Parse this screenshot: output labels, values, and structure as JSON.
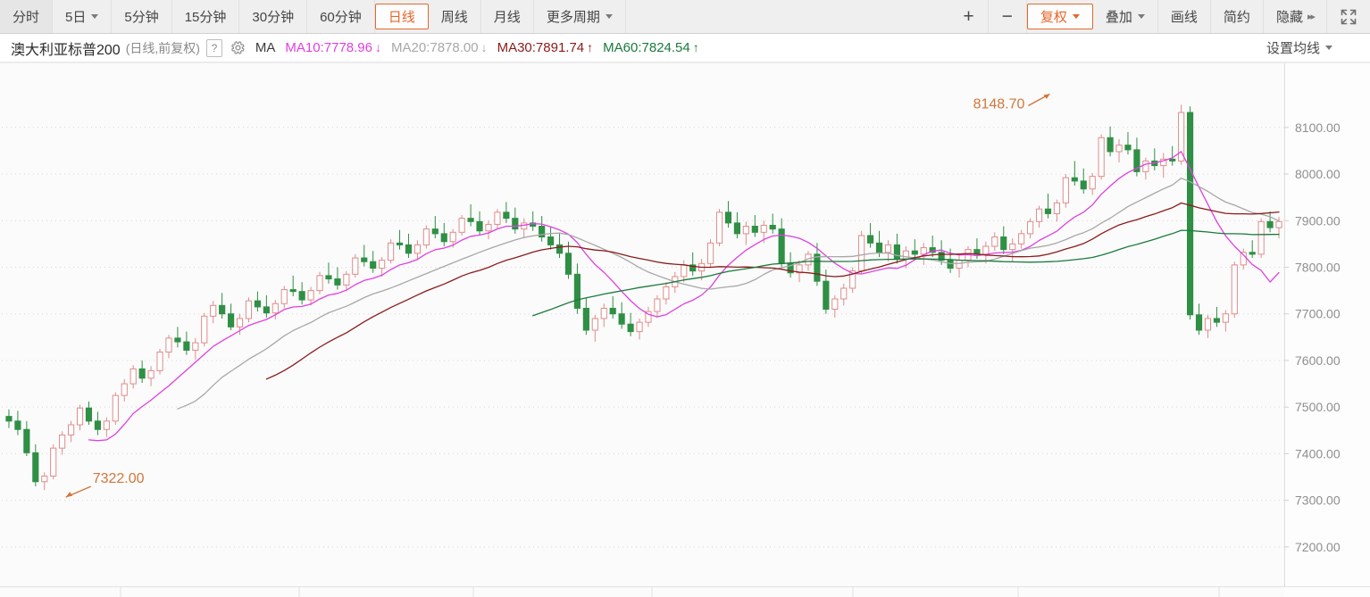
{
  "toolbar": {
    "left_items": [
      {
        "label": "分时",
        "name": "period-intraday",
        "active": false,
        "caret": false
      },
      {
        "label": "5日",
        "name": "period-5day",
        "active": false,
        "caret": true
      },
      {
        "label": "5分钟",
        "name": "period-5min",
        "active": false,
        "caret": false
      },
      {
        "label": "15分钟",
        "name": "period-15min",
        "active": false,
        "caret": false
      },
      {
        "label": "30分钟",
        "name": "period-30min",
        "active": false,
        "caret": false
      },
      {
        "label": "60分钟",
        "name": "period-60min",
        "active": false,
        "caret": false
      },
      {
        "label": "日线",
        "name": "period-daily",
        "active": true,
        "caret": false
      },
      {
        "label": "周线",
        "name": "period-weekly",
        "active": false,
        "caret": false
      },
      {
        "label": "月线",
        "name": "period-monthly",
        "active": false,
        "caret": false
      },
      {
        "label": "更多周期",
        "name": "period-more",
        "active": false,
        "caret": true
      }
    ],
    "zoom_in": "+",
    "zoom_out": "−",
    "right_items": [
      {
        "label": "复权",
        "name": "adjust-price",
        "active": true,
        "caret": true
      },
      {
        "label": "叠加",
        "name": "overlay",
        "active": false,
        "caret": true
      },
      {
        "label": "画线",
        "name": "draw-line",
        "active": false,
        "caret": false
      },
      {
        "label": "简约",
        "name": "simple-mode",
        "active": false,
        "caret": false
      },
      {
        "label": "隐藏",
        "name": "hide-panel",
        "active": false,
        "caret": false
      }
    ],
    "hide_arrows": "▸▸",
    "fullscreen_icon": "fullscreen-icon"
  },
  "infobar": {
    "instrument": "澳大利亚标普200",
    "meta": "(日线,前复权)",
    "help": "?",
    "gear_icon": "gear-icon",
    "indicator": "MA",
    "ma_values": [
      {
        "label": "MA10:7778.96",
        "arrow": "↓",
        "color": "#e040e0",
        "name": "ma10-value"
      },
      {
        "label": "MA20:7878.00",
        "arrow": "↓",
        "color": "#a8a8a8",
        "name": "ma20-value"
      },
      {
        "label": "MA30:7891.74",
        "arrow": "↑",
        "color": "#8b1a1a",
        "name": "ma30-value"
      },
      {
        "label": "MA60:7824.54",
        "arrow": "↑",
        "color": "#1a7a3c",
        "name": "ma60-value"
      }
    ],
    "settings_label": "设置均线"
  },
  "chart_data": {
    "type": "line",
    "title": "澳大利亚标普200 (日线,前复权)",
    "xlabel": "",
    "ylabel": "",
    "ylim": [
      7150,
      8180
    ],
    "yticks": [
      8100,
      8000,
      7900,
      7800,
      7700,
      7600,
      7500,
      7400,
      7300,
      7200
    ],
    "ytick_labels": [
      "8100.00",
      "8000.00",
      "7900.00",
      "7800.00",
      "7700.00",
      "7600.00",
      "7500.00",
      "7400.00",
      "7300.00",
      "7200.00"
    ],
    "grid": true,
    "legend_position": "top",
    "annotations": [
      {
        "text": "8148.70",
        "type": "high",
        "color": "#d2763c",
        "x_index": 118,
        "value": 8148.7
      },
      {
        "text": "7322.00",
        "type": "low",
        "color": "#d2763c",
        "x_index": 5,
        "value": 7322.0
      }
    ],
    "candle_colors": {
      "up": "#e08b8b",
      "up_fill": "#ffffff",
      "down": "#2f8f45",
      "down_fill": "#2f8f45"
    },
    "series": [
      {
        "name": "MA10",
        "color": "#e040e0",
        "last_value": 7778.96
      },
      {
        "name": "MA20",
        "color": "#a8a8a8",
        "last_value": 7878.0
      },
      {
        "name": "MA30",
        "color": "#8b1a1a",
        "last_value": 7891.74
      },
      {
        "name": "MA60",
        "color": "#1a7a3c",
        "last_value": 7824.54
      }
    ],
    "ohlc": [
      [
        7480,
        7495,
        7455,
        7470
      ],
      [
        7470,
        7492,
        7440,
        7452
      ],
      [
        7452,
        7470,
        7395,
        7402
      ],
      [
        7402,
        7420,
        7330,
        7340
      ],
      [
        7340,
        7360,
        7322,
        7352
      ],
      [
        7352,
        7420,
        7345,
        7412
      ],
      [
        7412,
        7448,
        7398,
        7440
      ],
      [
        7440,
        7470,
        7425,
        7462
      ],
      [
        7462,
        7505,
        7450,
        7498
      ],
      [
        7498,
        7512,
        7462,
        7470
      ],
      [
        7470,
        7490,
        7440,
        7452
      ],
      [
        7452,
        7478,
        7436,
        7470
      ],
      [
        7470,
        7532,
        7462,
        7525
      ],
      [
        7525,
        7560,
        7512,
        7550
      ],
      [
        7550,
        7590,
        7540,
        7582
      ],
      [
        7582,
        7600,
        7552,
        7562
      ],
      [
        7562,
        7588,
        7545,
        7578
      ],
      [
        7578,
        7625,
        7570,
        7618
      ],
      [
        7618,
        7655,
        7605,
        7648
      ],
      [
        7648,
        7672,
        7628,
        7640
      ],
      [
        7640,
        7662,
        7612,
        7622
      ],
      [
        7622,
        7648,
        7602,
        7638
      ],
      [
        7638,
        7702,
        7630,
        7695
      ],
      [
        7695,
        7728,
        7680,
        7718
      ],
      [
        7718,
        7745,
        7690,
        7700
      ],
      [
        7700,
        7722,
        7665,
        7672
      ],
      [
        7672,
        7700,
        7655,
        7690
      ],
      [
        7690,
        7735,
        7682,
        7728
      ],
      [
        7728,
        7748,
        7705,
        7715
      ],
      [
        7715,
        7740,
        7692,
        7702
      ],
      [
        7702,
        7730,
        7688,
        7722
      ],
      [
        7722,
        7760,
        7712,
        7752
      ],
      [
        7752,
        7782,
        7738,
        7748
      ],
      [
        7748,
        7768,
        7720,
        7730
      ],
      [
        7730,
        7758,
        7718,
        7750
      ],
      [
        7750,
        7790,
        7742,
        7782
      ],
      [
        7782,
        7810,
        7765,
        7775
      ],
      [
        7775,
        7800,
        7752,
        7762
      ],
      [
        7762,
        7792,
        7750,
        7785
      ],
      [
        7785,
        7828,
        7778,
        7820
      ],
      [
        7820,
        7848,
        7802,
        7812
      ],
      [
        7812,
        7835,
        7788,
        7798
      ],
      [
        7798,
        7822,
        7780,
        7815
      ],
      [
        7815,
        7860,
        7808,
        7852
      ],
      [
        7852,
        7880,
        7838,
        7848
      ],
      [
        7848,
        7872,
        7820,
        7830
      ],
      [
        7830,
        7858,
        7815,
        7848
      ],
      [
        7848,
        7890,
        7840,
        7882
      ],
      [
        7882,
        7910,
        7862,
        7872
      ],
      [
        7872,
        7895,
        7845,
        7855
      ],
      [
        7855,
        7882,
        7842,
        7875
      ],
      [
        7875,
        7912,
        7868,
        7905
      ],
      [
        7905,
        7935,
        7888,
        7898
      ],
      [
        7898,
        7920,
        7868,
        7878
      ],
      [
        7878,
        7900,
        7860,
        7892
      ],
      [
        7892,
        7925,
        7882,
        7918
      ],
      [
        7918,
        7940,
        7895,
        7905
      ],
      [
        7905,
        7928,
        7872,
        7882
      ],
      [
        7882,
        7905,
        7862,
        7895
      ],
      [
        7895,
        7920,
        7878,
        7888
      ],
      [
        7888,
        7910,
        7855,
        7865
      ],
      [
        7865,
        7888,
        7838,
        7848
      ],
      [
        7848,
        7872,
        7820,
        7830
      ],
      [
        7830,
        7855,
        7775,
        7785
      ],
      [
        7785,
        7808,
        7700,
        7712
      ],
      [
        7712,
        7735,
        7655,
        7665
      ],
      [
        7665,
        7698,
        7640,
        7690
      ],
      [
        7690,
        7722,
        7672,
        7712
      ],
      [
        7712,
        7738,
        7690,
        7700
      ],
      [
        7700,
        7725,
        7668,
        7678
      ],
      [
        7678,
        7702,
        7652,
        7662
      ],
      [
        7662,
        7690,
        7645,
        7682
      ],
      [
        7682,
        7715,
        7672,
        7705
      ],
      [
        7705,
        7740,
        7692,
        7732
      ],
      [
        7732,
        7768,
        7720,
        7758
      ],
      [
        7758,
        7790,
        7745,
        7780
      ],
      [
        7780,
        7815,
        7768,
        7805
      ],
      [
        7805,
        7832,
        7782,
        7792
      ],
      [
        7792,
        7818,
        7772,
        7808
      ],
      [
        7808,
        7860,
        7798,
        7852
      ],
      [
        7852,
        7925,
        7845,
        7918
      ],
      [
        7918,
        7942,
        7885,
        7895
      ],
      [
        7895,
        7918,
        7862,
        7872
      ],
      [
        7872,
        7898,
        7848,
        7888
      ],
      [
        7888,
        7912,
        7865,
        7875
      ],
      [
        7875,
        7900,
        7852,
        7890
      ],
      [
        7890,
        7915,
        7872,
        7882
      ],
      [
        7882,
        7905,
        7798,
        7808
      ],
      [
        7808,
        7832,
        7778,
        7788
      ],
      [
        7788,
        7815,
        7768,
        7805
      ],
      [
        7805,
        7835,
        7792,
        7828
      ],
      [
        7828,
        7852,
        7760,
        7770
      ],
      [
        7770,
        7795,
        7700,
        7710
      ],
      [
        7710,
        7740,
        7692,
        7732
      ],
      [
        7732,
        7765,
        7718,
        7755
      ],
      [
        7755,
        7800,
        7745,
        7792
      ],
      [
        7792,
        7878,
        7785,
        7868
      ],
      [
        7868,
        7895,
        7842,
        7852
      ],
      [
        7852,
        7878,
        7822,
        7832
      ],
      [
        7832,
        7858,
        7812,
        7848
      ],
      [
        7848,
        7872,
        7808,
        7818
      ],
      [
        7818,
        7845,
        7798,
        7835
      ],
      [
        7835,
        7860,
        7818,
        7828
      ],
      [
        7828,
        7852,
        7805,
        7842
      ],
      [
        7842,
        7868,
        7822,
        7832
      ],
      [
        7832,
        7858,
        7805,
        7815
      ],
      [
        7815,
        7840,
        7788,
        7798
      ],
      [
        7798,
        7825,
        7778,
        7815
      ],
      [
        7815,
        7845,
        7800,
        7838
      ],
      [
        7838,
        7862,
        7818,
        7828
      ],
      [
        7828,
        7855,
        7808,
        7845
      ],
      [
        7845,
        7875,
        7835,
        7865
      ],
      [
        7865,
        7888,
        7828,
        7838
      ],
      [
        7838,
        7862,
        7812,
        7850
      ],
      [
        7850,
        7880,
        7840,
        7872
      ],
      [
        7872,
        7905,
        7862,
        7898
      ],
      [
        7898,
        7932,
        7885,
        7925
      ],
      [
        7925,
        7958,
        7905,
        7915
      ],
      [
        7915,
        7945,
        7898,
        7938
      ],
      [
        7938,
        8000,
        7928,
        7992
      ],
      [
        7992,
        8028,
        7975,
        7985
      ],
      [
        7985,
        8012,
        7958,
        7968
      ],
      [
        7968,
        8002,
        7955,
        7995
      ],
      [
        7995,
        8085,
        7988,
        8078
      ],
      [
        8078,
        8102,
        8038,
        8048
      ],
      [
        8048,
        8075,
        8025,
        8062
      ],
      [
        8062,
        8090,
        8042,
        8052
      ],
      [
        8052,
        8078,
        7995,
        8005
      ],
      [
        8005,
        8035,
        7988,
        8028
      ],
      [
        8028,
        8055,
        8008,
        8018
      ],
      [
        8018,
        8045,
        7992,
        8032
      ],
      [
        8032,
        8060,
        8018,
        8028
      ],
      [
        8028,
        8148.7,
        8020,
        8132
      ],
      [
        8132,
        8145,
        7688,
        7698
      ],
      [
        7698,
        7722,
        7655,
        7665
      ],
      [
        7665,
        7698,
        7648,
        7690
      ],
      [
        7690,
        7715,
        7672,
        7682
      ],
      [
        7682,
        7708,
        7662,
        7700
      ],
      [
        7700,
        7812,
        7692,
        7805
      ],
      [
        7805,
        7840,
        7795,
        7832
      ],
      [
        7832,
        7858,
        7820,
        7828
      ],
      [
        7828,
        7905,
        7820,
        7898
      ],
      [
        7898,
        7920,
        7875,
        7885
      ],
      [
        7885,
        7908,
        7862,
        7898
      ]
    ]
  }
}
